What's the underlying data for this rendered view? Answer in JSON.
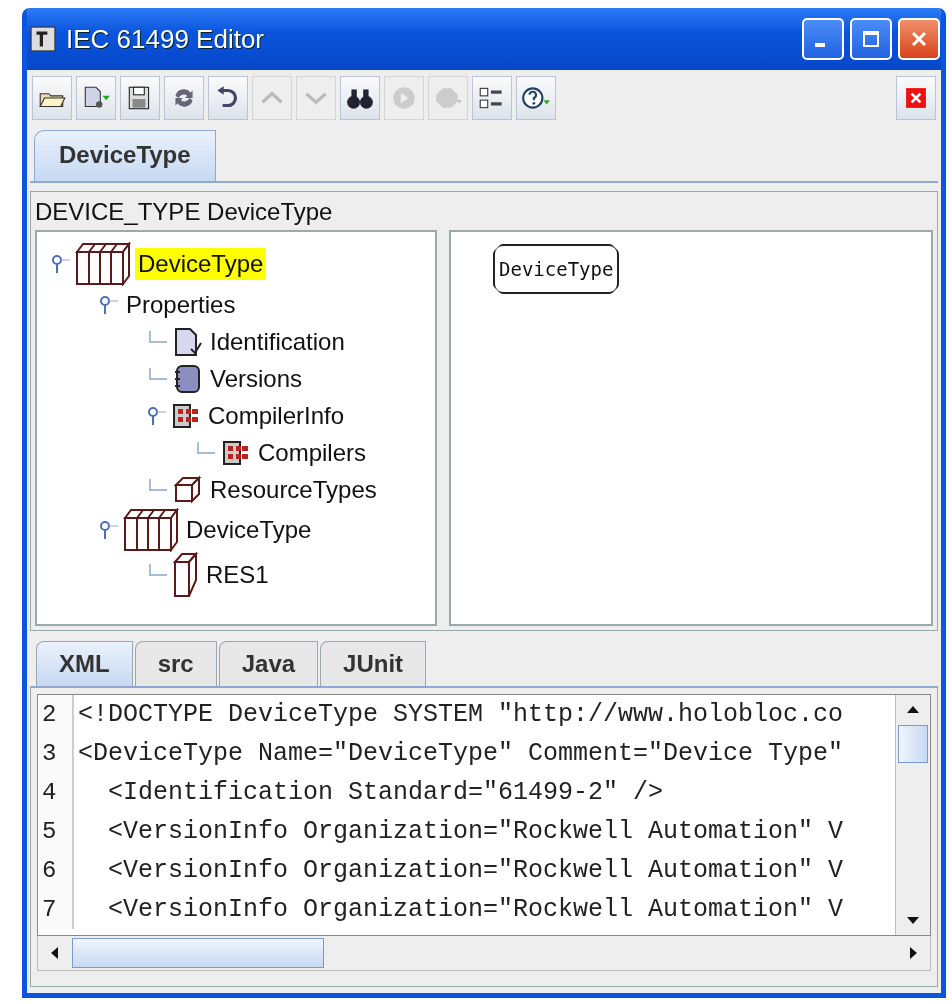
{
  "window": {
    "title": "IEC 61499 Editor"
  },
  "toolbar": [
    {
      "kind": "open",
      "disabled": false
    },
    {
      "kind": "new",
      "disabled": false
    },
    {
      "kind": "save",
      "disabled": false
    },
    {
      "kind": "refresh",
      "disabled": false
    },
    {
      "kind": "undo",
      "disabled": false
    },
    {
      "kind": "up",
      "disabled": true
    },
    {
      "kind": "down",
      "disabled": true
    },
    {
      "kind": "find",
      "disabled": false
    },
    {
      "kind": "run",
      "disabled": true
    },
    {
      "kind": "stop",
      "disabled": true
    },
    {
      "kind": "checklist",
      "disabled": false
    },
    {
      "kind": "help",
      "disabled": false
    }
  ],
  "editor_tabs": [
    {
      "label": "DeviceType",
      "selected": true
    }
  ],
  "header": "DEVICE_TYPE DeviceType",
  "tree": {
    "nodes": [
      {
        "label": "DeviceType",
        "kind": "device",
        "selected": true,
        "expanded": true,
        "children": [
          {
            "label": "Properties",
            "kind": "plain",
            "selected": false,
            "expanded": true,
            "children": [
              {
                "label": "Identification",
                "kind": "document",
                "selected": false
              },
              {
                "label": "Versions",
                "kind": "book",
                "selected": false
              },
              {
                "label": "CompilerInfo",
                "kind": "compiler",
                "selected": false,
                "expanded": true,
                "children": [
                  {
                    "label": "Compilers",
                    "kind": "compiler",
                    "selected": false
                  }
                ]
              },
              {
                "label": "ResourceTypes",
                "kind": "resource",
                "selected": false
              }
            ]
          },
          {
            "label": "DeviceType",
            "kind": "device",
            "selected": false,
            "expanded": true,
            "children": [
              {
                "label": "RES1",
                "kind": "resource-tall",
                "selected": false
              }
            ]
          }
        ]
      }
    ]
  },
  "diagram": {
    "blocks": [
      {
        "label": "DeviceType"
      }
    ]
  },
  "source_tabs": [
    {
      "label": "XML",
      "selected": true
    },
    {
      "label": "src",
      "selected": false
    },
    {
      "label": "Java",
      "selected": false
    },
    {
      "label": "JUnit",
      "selected": false
    }
  ],
  "code": {
    "lines": [
      {
        "number": "2",
        "text": "<!DOCTYPE DeviceType SYSTEM \"http://www.holobloc.co"
      },
      {
        "number": "3",
        "text": "<DeviceType Name=\"DeviceType\" Comment=\"Device Type\""
      },
      {
        "number": "4",
        "text": "  <Identification Standard=\"61499-2\" />"
      },
      {
        "number": "5",
        "text": "  <VersionInfo Organization=\"Rockwell Automation\" V"
      },
      {
        "number": "6",
        "text": "  <VersionInfo Organization=\"Rockwell Automation\" V"
      },
      {
        "number": "7",
        "text": "  <VersionInfo Organization=\"Rockwell Automation\" V"
      }
    ]
  }
}
